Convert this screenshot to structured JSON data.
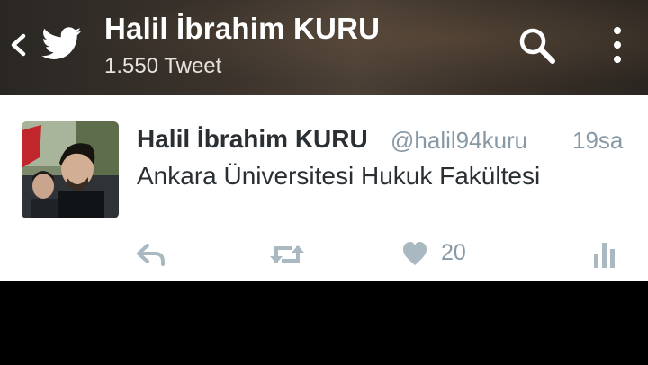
{
  "header": {
    "title": "Halil İbrahim KURU",
    "tweet_count": "1.550 Tweet"
  },
  "tweet": {
    "name": "Halil İbrahim KURU",
    "handle": "@halil94kuru",
    "time": "19sa",
    "text": "Ankara Üniversitesi Hukuk Fakültesi",
    "like_count": "20"
  },
  "colors": {
    "text_primary": "#292f33",
    "text_secondary": "#8899a6",
    "icon_gray": "#aab8c2"
  },
  "icons": [
    "back-arrow-icon",
    "twitter-bird-icon",
    "search-icon",
    "overflow-menu-icon",
    "reply-icon",
    "retweet-icon",
    "heart-icon",
    "analytics-icon"
  ]
}
